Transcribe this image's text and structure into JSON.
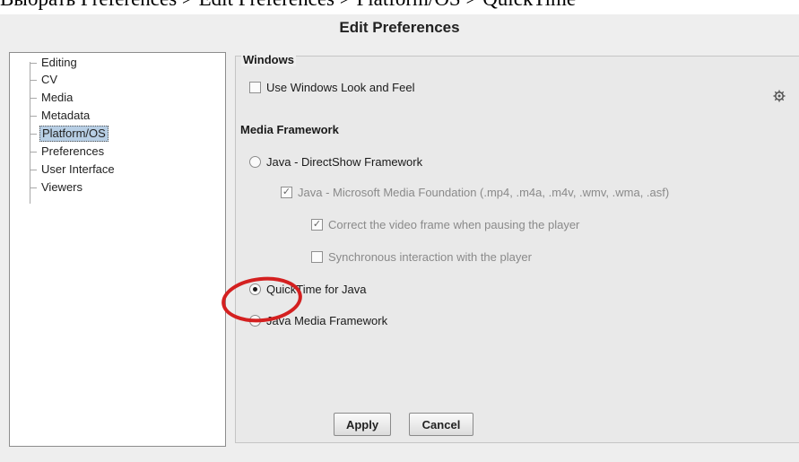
{
  "caption": "Выбрать Preferences > Edit Preferences > Platform/OS > QuickTime",
  "window": {
    "title": "Edit Preferences"
  },
  "tree": {
    "items": [
      {
        "label": "Editing",
        "selected": false
      },
      {
        "label": "CV",
        "selected": false
      },
      {
        "label": "Media",
        "selected": false
      },
      {
        "label": "Metadata",
        "selected": false
      },
      {
        "label": "Platform/OS",
        "selected": true
      },
      {
        "label": "Preferences",
        "selected": false
      },
      {
        "label": "User Interface",
        "selected": false
      },
      {
        "label": "Viewers",
        "selected": false
      }
    ]
  },
  "panel": {
    "group_title": "Windows",
    "windows_laf": {
      "label": "Use Windows Look and Feel",
      "checked": false
    },
    "gear_icon": "gear-icon",
    "media_framework_title": "Media Framework",
    "options": {
      "directshow": {
        "label": "Java - DirectShow Framework",
        "selected": false
      },
      "mmf": {
        "label": "Java - Microsoft Media Foundation (.mp4, .m4a, .m4v, .wmv, .wma, .asf)",
        "checked": true,
        "enabled": false
      },
      "correct_frame": {
        "label": "Correct the video frame when pausing the player",
        "checked": true,
        "enabled": false
      },
      "sync": {
        "label": "Synchronous interaction with the player",
        "checked": false,
        "enabled": false
      },
      "quicktime": {
        "label": "QuickTime for Java",
        "selected": true
      },
      "jmf": {
        "label": "Java Media Framework",
        "selected": false
      }
    }
  },
  "buttons": {
    "apply": "Apply",
    "cancel": "Cancel"
  },
  "colors": {
    "highlight_circle": "#d42020",
    "selection": "#b8cfe5"
  }
}
